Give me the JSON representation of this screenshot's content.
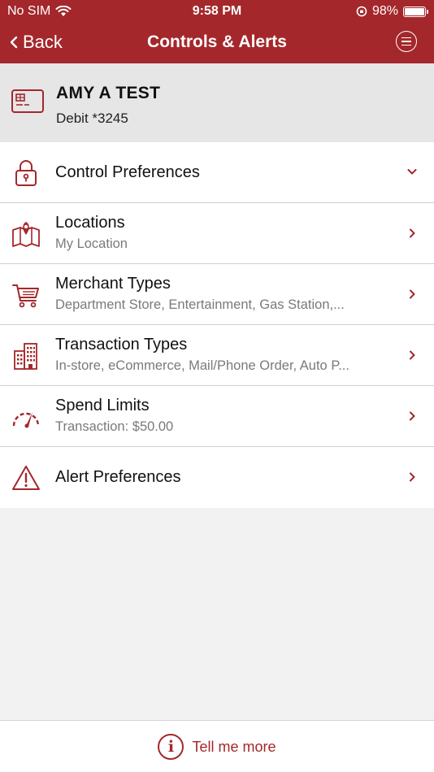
{
  "status_bar": {
    "carrier": "No SIM",
    "time": "9:58 PM",
    "battery": "98%"
  },
  "nav": {
    "back_label": "Back",
    "title": "Controls & Alerts",
    "menu_icon": "menu-icon"
  },
  "card": {
    "name": "AMY A TEST",
    "account": "Debit *3245"
  },
  "items": [
    {
      "label": "Control Preferences",
      "subtitle": "",
      "icon": "lock-icon",
      "arrow": "chevron-down-icon"
    },
    {
      "label": "Locations",
      "subtitle": "My Location",
      "icon": "map-icon",
      "arrow": "chevron-right-icon"
    },
    {
      "label": "Merchant Types",
      "subtitle": "Department Store, Entertainment, Gas Station,...",
      "icon": "cart-icon",
      "arrow": "chevron-right-icon"
    },
    {
      "label": "Transaction Types",
      "subtitle": "In-store, eCommerce, Mail/Phone Order, Auto P...",
      "icon": "buildings-icon",
      "arrow": "chevron-right-icon"
    },
    {
      "label": "Spend Limits",
      "subtitle": "Transaction: $50.00",
      "icon": "gauge-icon",
      "arrow": "chevron-right-icon"
    },
    {
      "label": "Alert Preferences",
      "subtitle": "",
      "icon": "warning-icon",
      "arrow": "chevron-right-icon"
    }
  ],
  "footer": {
    "tell_me_more": "Tell me more",
    "info_glyph": "i"
  },
  "colors": {
    "brand": "#a4272b",
    "card_bg": "#e6e6e6",
    "page_bg": "#f2f2f2"
  }
}
